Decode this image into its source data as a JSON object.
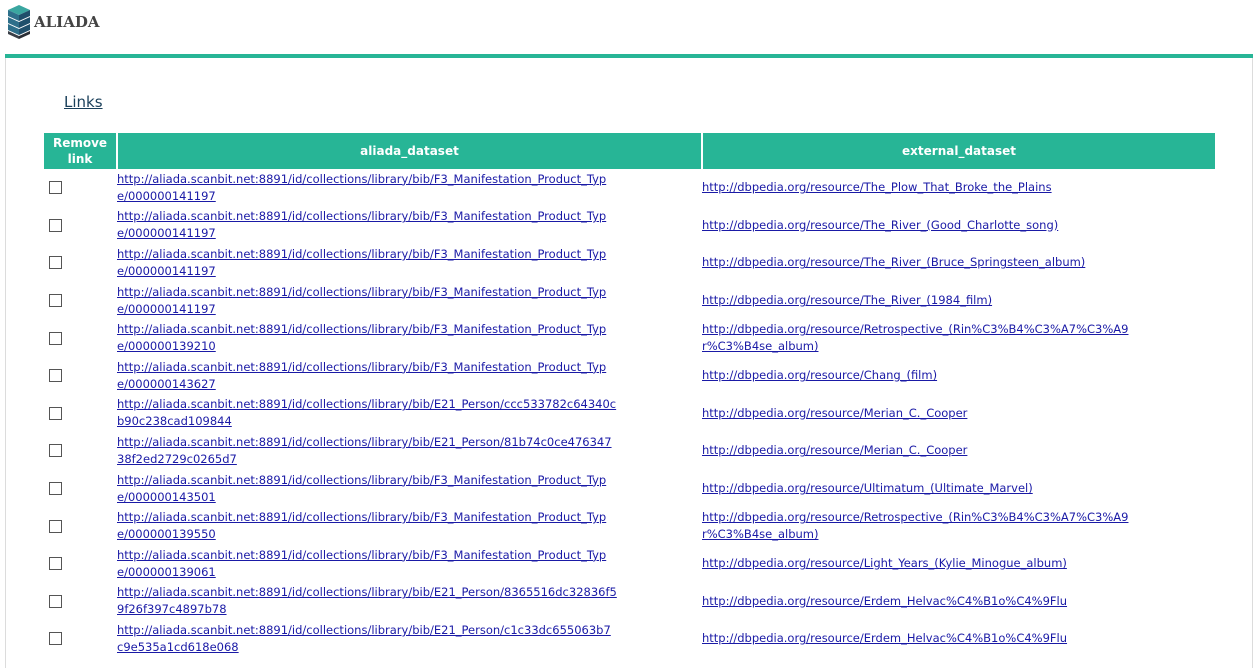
{
  "brand": {
    "name": "ALIADA",
    "accent": "#27b596"
  },
  "section_title": "Links",
  "table": {
    "headers": [
      "Remove link",
      "aliada_dataset",
      "external_dataset"
    ],
    "rows": [
      {
        "aliada": "http://aliada.scanbit.net:8891/id/collections/library/bib/F3_Manifestation_Product_Type/000000141197",
        "external": "http://dbpedia.org/resource/The_Plow_That_Broke_the_Plains"
      },
      {
        "aliada": "http://aliada.scanbit.net:8891/id/collections/library/bib/F3_Manifestation_Product_Type/000000141197",
        "external": "http://dbpedia.org/resource/The_River_(Good_Charlotte_song)"
      },
      {
        "aliada": "http://aliada.scanbit.net:8891/id/collections/library/bib/F3_Manifestation_Product_Type/000000141197",
        "external": "http://dbpedia.org/resource/The_River_(Bruce_Springsteen_album)"
      },
      {
        "aliada": "http://aliada.scanbit.net:8891/id/collections/library/bib/F3_Manifestation_Product_Type/000000141197",
        "external": "http://dbpedia.org/resource/The_River_(1984_film)"
      },
      {
        "aliada": "http://aliada.scanbit.net:8891/id/collections/library/bib/F3_Manifestation_Product_Type/000000139210",
        "external": "http://dbpedia.org/resource/Retrospective_(Rin%C3%B4%C3%A7%C3%A9r%C3%B4se_album)"
      },
      {
        "aliada": "http://aliada.scanbit.net:8891/id/collections/library/bib/F3_Manifestation_Product_Type/000000143627",
        "external": "http://dbpedia.org/resource/Chang_(film)"
      },
      {
        "aliada": "http://aliada.scanbit.net:8891/id/collections/library/bib/E21_Person/ccc533782c64340cb90c238cad109844",
        "external": "http://dbpedia.org/resource/Merian_C._Cooper"
      },
      {
        "aliada": "http://aliada.scanbit.net:8891/id/collections/library/bib/E21_Person/81b74c0ce47634738f2ed2729c0265d7",
        "external": "http://dbpedia.org/resource/Merian_C._Cooper"
      },
      {
        "aliada": "http://aliada.scanbit.net:8891/id/collections/library/bib/F3_Manifestation_Product_Type/000000143501",
        "external": "http://dbpedia.org/resource/Ultimatum_(Ultimate_Marvel)"
      },
      {
        "aliada": "http://aliada.scanbit.net:8891/id/collections/library/bib/F3_Manifestation_Product_Type/000000139550",
        "external": "http://dbpedia.org/resource/Retrospective_(Rin%C3%B4%C3%A7%C3%A9r%C3%B4se_album)"
      },
      {
        "aliada": "http://aliada.scanbit.net:8891/id/collections/library/bib/F3_Manifestation_Product_Type/000000139061",
        "external": "http://dbpedia.org/resource/Light_Years_(Kylie_Minogue_album)"
      },
      {
        "aliada": "http://aliada.scanbit.net:8891/id/collections/library/bib/E21_Person/8365516dc32836f59f26f397c4897b78",
        "external": "http://dbpedia.org/resource/Erdem_Helvac%C4%B1o%C4%9Flu"
      },
      {
        "aliada": "http://aliada.scanbit.net:8891/id/collections/library/bib/E21_Person/c1c33dc655063b7c9e535a1cd618e068",
        "external": "http://dbpedia.org/resource/Erdem_Helvac%C4%B1o%C4%9Flu"
      }
    ]
  }
}
